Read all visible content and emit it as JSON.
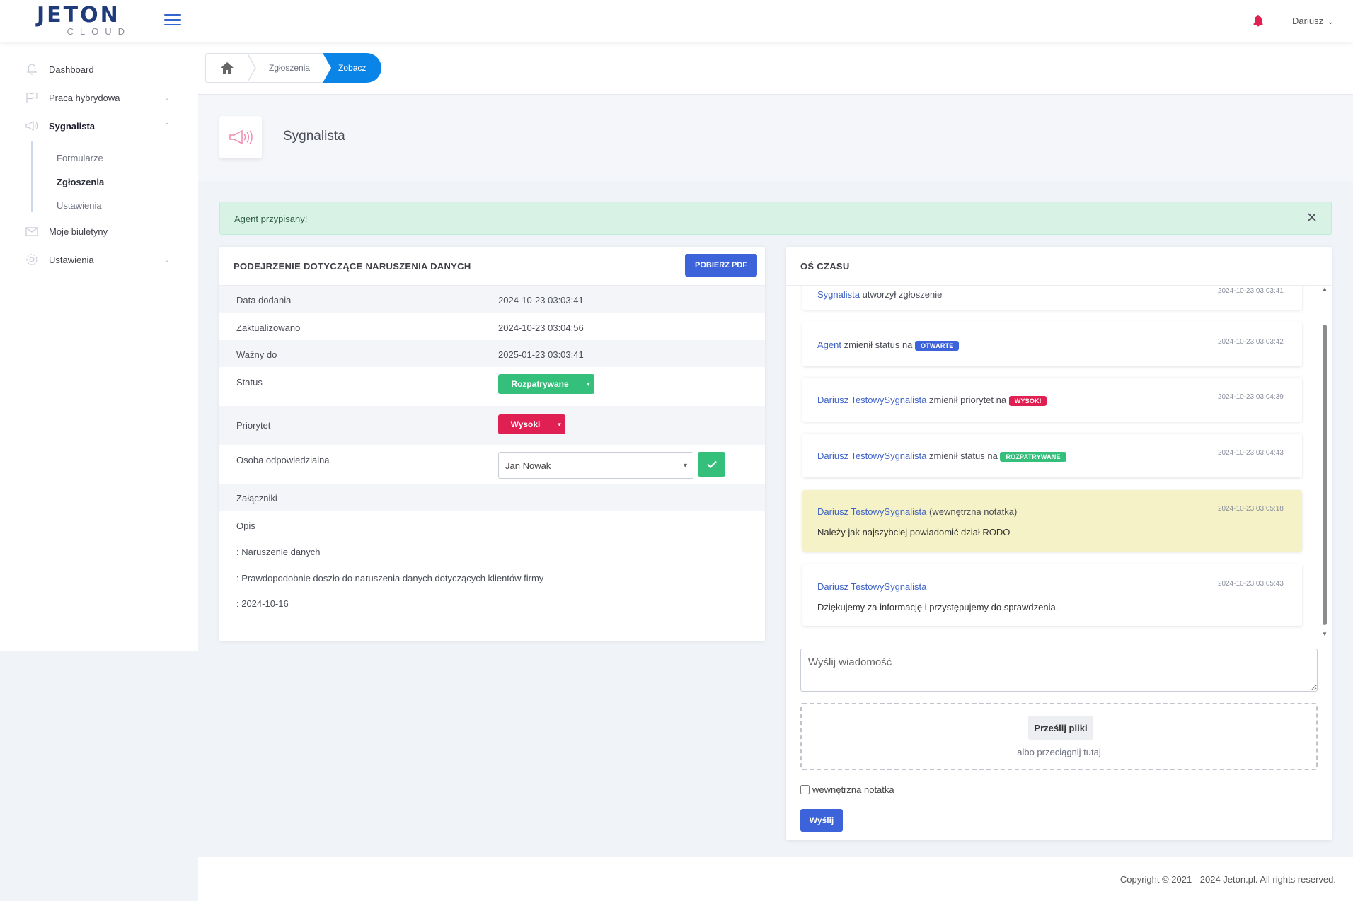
{
  "brand": {
    "name": "JETON",
    "sub": "CLOUD"
  },
  "topbar": {
    "user": "Dariusz"
  },
  "sidebar": {
    "items": [
      {
        "label": "Dashboard"
      },
      {
        "label": "Praca hybrydowa"
      },
      {
        "label": "Sygnalista"
      },
      {
        "label": "Moje biuletyny"
      },
      {
        "label": "Ustawienia"
      }
    ],
    "sub_items": [
      {
        "label": "Formularze"
      },
      {
        "label": "Zgłoszenia"
      },
      {
        "label": "Ustawienia"
      }
    ]
  },
  "breadcrumb": {
    "middle": "Zgłoszenia",
    "active": "Zobacz"
  },
  "page": {
    "title": "Sygnalista"
  },
  "alert": {
    "text": "Agent przypisany!"
  },
  "report": {
    "title": "PODEJRZENIE DOTYCZĄCE NARUSZENIA DANYCH",
    "pdf_button": "POBIERZ PDF",
    "fields": {
      "date_added_label": "Data dodania",
      "date_added": "2024-10-23 03:03:41",
      "updated_label": "Zaktualizowano",
      "updated": "2024-10-23 03:04:56",
      "valid_label": "Ważny do",
      "valid": "2025-01-23 03:03:41",
      "status_label": "Status",
      "status": "Rozpatrywane",
      "priority_label": "Priorytet",
      "priority": "Wysoki",
      "assignee_label": "Osoba odpowiedzialna",
      "assignee": "Jan Nowak",
      "attachments_label": "Załączniki",
      "description_label": "Opis"
    },
    "description_lines": [
      ": Naruszenie danych",
      ": Prawdopodobnie doszło do naruszenia danych dotyczących klientów firmy",
      ": 2024-10-16"
    ]
  },
  "timeline": {
    "title": "OŚ CZASU",
    "events": [
      {
        "who": "Sygnalista",
        "text": " utworzył zgłoszenie",
        "badge": "",
        "date": "2024-10-23 03:03:41"
      },
      {
        "who": "Agent",
        "text": " zmienił status na ",
        "badge": "OTWARTE",
        "date": "2024-10-23 03:03:42"
      },
      {
        "who": "Dariusz TestowySygnalista",
        "text": " zmienił priorytet na ",
        "badge": "WYSOKI",
        "date": "2024-10-23 03:04:39"
      },
      {
        "who": "Dariusz TestowySygnalista",
        "text": " zmienił status na ",
        "badge": "ROZPATRYWANE",
        "date": "2024-10-23 03:04:43"
      },
      {
        "who": "Dariusz TestowySygnalista",
        "text": " (wewnętrzna notatka)",
        "message": "Należy jak najszybciej powiadomić dział RODO",
        "date": "2024-10-23 03:05:18"
      },
      {
        "who": "Dariusz TestowySygnalista",
        "text": "",
        "message": "Dziękujemy za informację i przystępujemy do sprawdzenia.",
        "date": "2024-10-23 03:05:43"
      }
    ],
    "message_placeholder": "Wyślij wiadomość",
    "upload_button": "Prześlij pliki",
    "upload_hint": "albo przeciągnij tutaj",
    "internal_note_label": "wewnętrzna notatka",
    "send_button": "Wyślij"
  },
  "footer": {
    "copyright": "Copyright © 2021 - 2024 Jeton.pl. All rights reserved."
  },
  "colors": {
    "primary": "#3c63d9",
    "success": "#34bf7a",
    "danger": "#e01f52",
    "note": "#f5f2c8",
    "breadcrumb_active": "#0b84e8"
  }
}
